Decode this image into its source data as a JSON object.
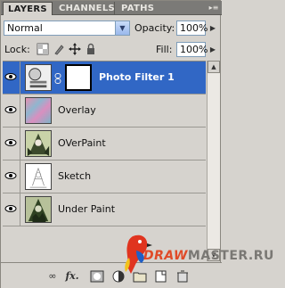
{
  "tabs": [
    {
      "label": "LAYERS",
      "active": true
    },
    {
      "label": "CHANNELS",
      "active": false
    },
    {
      "label": "PATHS",
      "active": false
    }
  ],
  "panel_menu_icon": "panel-menu-arrow-icon",
  "blend_mode": "Normal",
  "opacity": {
    "label": "Opacity:",
    "value": "100%"
  },
  "lock": {
    "label": "Lock:",
    "icons": [
      "lock-transparent-icon",
      "lock-paint-icon",
      "lock-position-icon",
      "lock-all-icon"
    ]
  },
  "fill": {
    "label": "Fill:",
    "value": "100%"
  },
  "layers": [
    {
      "name": "Photo Filter 1",
      "selected": true,
      "visible": true,
      "type": "adjustment"
    },
    {
      "name": "Overlay",
      "selected": false,
      "visible": true,
      "type": "pixel"
    },
    {
      "name": "OVerPaint",
      "selected": false,
      "visible": true,
      "type": "pixel"
    },
    {
      "name": "Sketch",
      "selected": false,
      "visible": true,
      "type": "pixel"
    },
    {
      "name": "Under Paint",
      "selected": false,
      "visible": true,
      "type": "pixel"
    }
  ],
  "bottom_icons": [
    "link-layers-icon",
    "fx-icon",
    "add-mask-icon",
    "adjustment-layer-icon",
    "group-folder-icon",
    "new-layer-icon",
    "trash-icon"
  ],
  "watermark": {
    "prefix": "DRAW",
    "suffix": "MASTER.RU"
  },
  "colors": {
    "selection": "#3167c5",
    "panel": "#d6d3ce",
    "tabbar": "#7b7a77"
  }
}
